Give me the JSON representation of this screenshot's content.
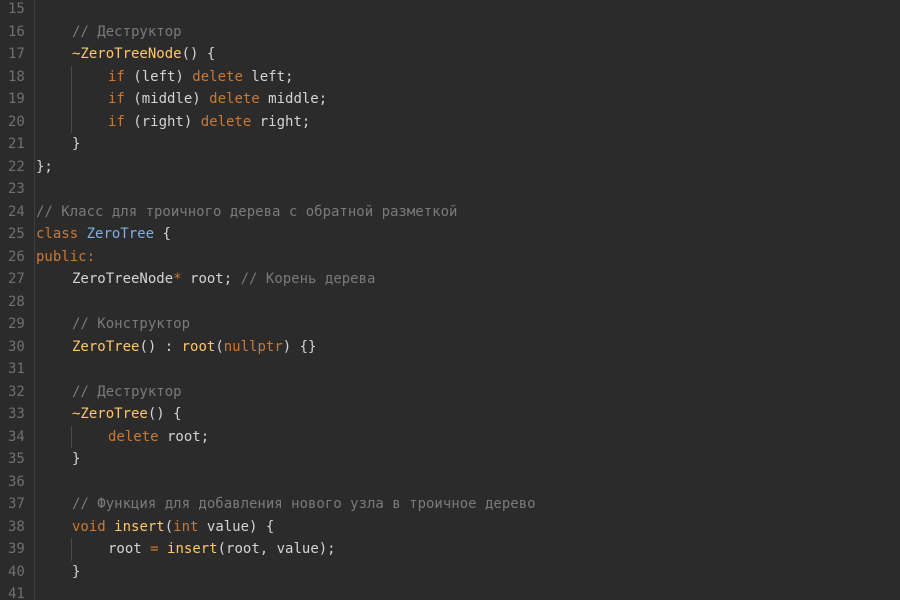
{
  "colors": {
    "background": "#2b2b2b",
    "keyword": "#cc7832",
    "function": "#ffc66d",
    "class_name": "#7fb0e6",
    "comment": "#7a7a7a",
    "plain": "#d4d4d4",
    "line_number": "#6e7073"
  },
  "editor": {
    "lines": [
      {
        "num": "15",
        "indent": 0,
        "guides": [],
        "tokens": []
      },
      {
        "num": "16",
        "indent": 1,
        "guides": [],
        "tokens": [
          {
            "t": "com",
            "v": "// Деструктор"
          }
        ]
      },
      {
        "num": "17",
        "indent": 1,
        "guides": [],
        "tokens": [
          {
            "t": "fn",
            "v": "~ZeroTreeNode"
          },
          {
            "t": "plain",
            "v": "() {"
          }
        ]
      },
      {
        "num": "18",
        "indent": 2,
        "guides": [
          1
        ],
        "tokens": [
          {
            "t": "kw",
            "v": "if"
          },
          {
            "t": "plain",
            "v": " (left) "
          },
          {
            "t": "kw",
            "v": "delete"
          },
          {
            "t": "plain",
            "v": " left;"
          }
        ]
      },
      {
        "num": "19",
        "indent": 2,
        "guides": [
          1
        ],
        "tokens": [
          {
            "t": "kw",
            "v": "if"
          },
          {
            "t": "plain",
            "v": " (middle) "
          },
          {
            "t": "kw",
            "v": "delete"
          },
          {
            "t": "plain",
            "v": " middle;"
          }
        ]
      },
      {
        "num": "20",
        "indent": 2,
        "guides": [
          1
        ],
        "tokens": [
          {
            "t": "kw",
            "v": "if"
          },
          {
            "t": "plain",
            "v": " (right) "
          },
          {
            "t": "kw",
            "v": "delete"
          },
          {
            "t": "plain",
            "v": " right;"
          }
        ]
      },
      {
        "num": "21",
        "indent": 1,
        "guides": [],
        "tokens": [
          {
            "t": "plain",
            "v": "}"
          }
        ]
      },
      {
        "num": "22",
        "indent": 0,
        "guides": [],
        "tokens": [
          {
            "t": "plain",
            "v": "};"
          }
        ]
      },
      {
        "num": "23",
        "indent": 0,
        "guides": [],
        "tokens": []
      },
      {
        "num": "24",
        "indent": 0,
        "guides": [],
        "tokens": [
          {
            "t": "com",
            "v": "// Класс для троичного дерева с обратной разметкой"
          }
        ]
      },
      {
        "num": "25",
        "indent": 0,
        "guides": [],
        "tokens": [
          {
            "t": "kw",
            "v": "class"
          },
          {
            "t": "plain",
            "v": " "
          },
          {
            "t": "cls",
            "v": "ZeroTree"
          },
          {
            "t": "plain",
            "v": " {"
          }
        ]
      },
      {
        "num": "26",
        "indent": 0,
        "guides": [],
        "tokens": [
          {
            "t": "kw",
            "v": "public:"
          }
        ]
      },
      {
        "num": "27",
        "indent": 1,
        "guides": [],
        "tokens": [
          {
            "t": "plain",
            "v": "ZeroTreeNode"
          },
          {
            "t": "kw",
            "v": "*"
          },
          {
            "t": "plain",
            "v": " root; "
          },
          {
            "t": "com",
            "v": "// Корень дерева"
          }
        ]
      },
      {
        "num": "28",
        "indent": 0,
        "guides": [],
        "tokens": []
      },
      {
        "num": "29",
        "indent": 1,
        "guides": [],
        "tokens": [
          {
            "t": "com",
            "v": "// Конструктор"
          }
        ]
      },
      {
        "num": "30",
        "indent": 1,
        "guides": [],
        "tokens": [
          {
            "t": "fn",
            "v": "ZeroTree"
          },
          {
            "t": "plain",
            "v": "() : "
          },
          {
            "t": "fn",
            "v": "root"
          },
          {
            "t": "plain",
            "v": "("
          },
          {
            "t": "kw",
            "v": "nullptr"
          },
          {
            "t": "plain",
            "v": ") {}"
          }
        ]
      },
      {
        "num": "31",
        "indent": 0,
        "guides": [],
        "tokens": []
      },
      {
        "num": "32",
        "indent": 1,
        "guides": [],
        "tokens": [
          {
            "t": "com",
            "v": "// Деструктор"
          }
        ]
      },
      {
        "num": "33",
        "indent": 1,
        "guides": [],
        "tokens": [
          {
            "t": "fn",
            "v": "~ZeroTree"
          },
          {
            "t": "plain",
            "v": "() {"
          }
        ]
      },
      {
        "num": "34",
        "indent": 2,
        "guides": [
          1
        ],
        "tokens": [
          {
            "t": "kw",
            "v": "delete"
          },
          {
            "t": "plain",
            "v": " root;"
          }
        ]
      },
      {
        "num": "35",
        "indent": 1,
        "guides": [],
        "tokens": [
          {
            "t": "plain",
            "v": "}"
          }
        ]
      },
      {
        "num": "36",
        "indent": 0,
        "guides": [],
        "tokens": []
      },
      {
        "num": "37",
        "indent": 1,
        "guides": [],
        "tokens": [
          {
            "t": "com",
            "v": "// Функция для добавления нового узла в троичное дерево"
          }
        ]
      },
      {
        "num": "38",
        "indent": 1,
        "guides": [],
        "tokens": [
          {
            "t": "kw",
            "v": "void"
          },
          {
            "t": "plain",
            "v": " "
          },
          {
            "t": "fn",
            "v": "insert"
          },
          {
            "t": "plain",
            "v": "("
          },
          {
            "t": "kw",
            "v": "int"
          },
          {
            "t": "plain",
            "v": " value) {"
          }
        ]
      },
      {
        "num": "39",
        "indent": 2,
        "guides": [
          1
        ],
        "tokens": [
          {
            "t": "plain",
            "v": "root "
          },
          {
            "t": "kw",
            "v": "="
          },
          {
            "t": "plain",
            "v": " "
          },
          {
            "t": "fn",
            "v": "insert"
          },
          {
            "t": "plain",
            "v": "(root, value);"
          }
        ]
      },
      {
        "num": "40",
        "indent": 1,
        "guides": [],
        "tokens": [
          {
            "t": "plain",
            "v": "}"
          }
        ]
      },
      {
        "num": "41",
        "indent": 0,
        "guides": [],
        "tokens": []
      }
    ]
  }
}
